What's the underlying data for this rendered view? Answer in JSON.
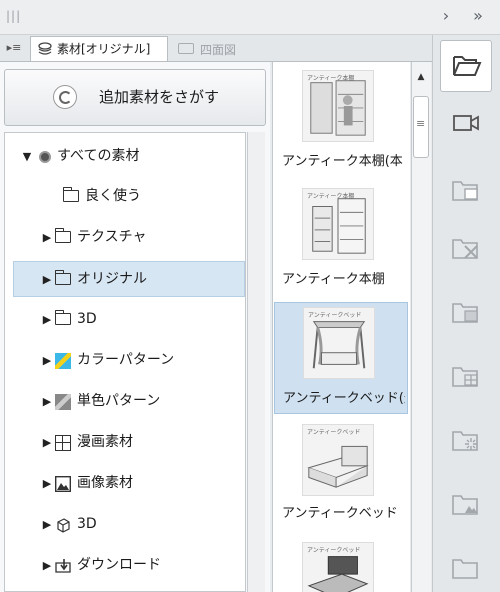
{
  "palette": {
    "panel_bg": "#e9ecee",
    "selection": "#d7e6f3",
    "accent_blue": "#2f86c9"
  },
  "tabs": [
    {
      "label": "素材[オリジナル]",
      "icon": "layers-icon",
      "active": true
    },
    {
      "label": "四面図",
      "icon": "camera-icon",
      "active": false
    }
  ],
  "search": {
    "label": "追加素材をさがす",
    "icon": "clipstudio-assets-icon"
  },
  "tree": [
    {
      "label": "すべての素材",
      "icon": "all-materials-icon",
      "expanded": true,
      "selected": false
    },
    {
      "label": "良く使う",
      "icon": "folder-icon",
      "expanded": false,
      "selected": false
    },
    {
      "label": "テクスチャ",
      "icon": "folder-icon",
      "expanded": false,
      "selected": false
    },
    {
      "label": "オリジナル",
      "icon": "folder-icon",
      "expanded": false,
      "selected": true
    },
    {
      "label": "3D",
      "icon": "folder-icon",
      "expanded": false,
      "selected": false
    },
    {
      "label": "カラーパターン",
      "icon": "color-pattern-icon",
      "expanded": false,
      "selected": false
    },
    {
      "label": "単色パターン",
      "icon": "mono-pattern-icon",
      "expanded": false,
      "selected": false
    },
    {
      "label": "漫画素材",
      "icon": "manga-material-icon",
      "expanded": false,
      "selected": false
    },
    {
      "label": "画像素材",
      "icon": "image-material-icon",
      "expanded": false,
      "selected": false
    },
    {
      "label": "3D",
      "icon": "cube-icon",
      "expanded": false,
      "selected": false
    },
    {
      "label": "ダウンロード",
      "icon": "download-folder-icon",
      "expanded": false,
      "selected": false
    }
  ],
  "materials": [
    {
      "label": "アンティーク本棚(本",
      "caption": "アンティーク本棚",
      "selected": false
    },
    {
      "label": "アンティーク本棚",
      "caption": "アンティーク本棚",
      "selected": false
    },
    {
      "label": "アンティークベッド(天",
      "caption": "アンティークベッド",
      "selected": true
    },
    {
      "label": "アンティークベッド",
      "caption": "アンティークベッド",
      "selected": false
    },
    {
      "label": "",
      "caption": "アンティークベッド",
      "selected": false
    }
  ],
  "side_icons": [
    "open-folder-icon",
    "camera-icon",
    "folder-image-icon",
    "folder-delete-icon",
    "folder-pattern-icon",
    "folder-grid-icon",
    "folder-burst-icon",
    "folder-mountain-icon"
  ]
}
